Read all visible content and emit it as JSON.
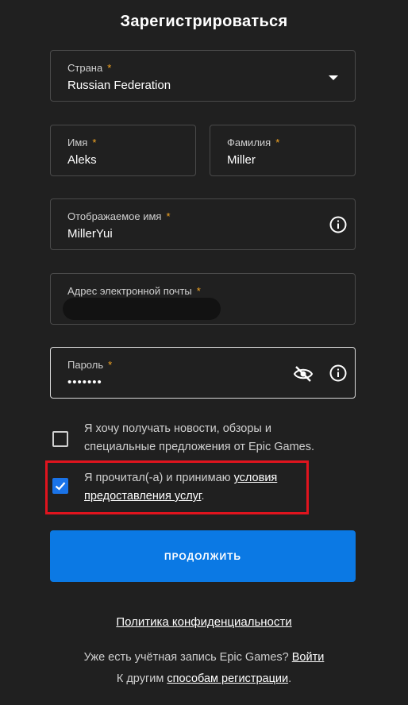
{
  "page": {
    "title": "Зарегистрироваться"
  },
  "form": {
    "country": {
      "label": "Страна",
      "required_mark": "*",
      "value": "Russian Federation"
    },
    "first_name": {
      "label": "Имя",
      "required_mark": "*",
      "value": "Aleks"
    },
    "last_name": {
      "label": "Фамилия",
      "required_mark": "*",
      "value": "Miller"
    },
    "display_name": {
      "label": "Отображаемое имя",
      "required_mark": "*",
      "value": "MillerYui"
    },
    "email": {
      "label": "Адрес электронной почты",
      "required_mark": "*",
      "value": ""
    },
    "password": {
      "label": "Пароль",
      "required_mark": "*",
      "value": "•••••••"
    }
  },
  "checkboxes": {
    "newsletter": {
      "checked": false,
      "line1": "Я хочу получать новости, обзоры и",
      "line2": "специальные предложения от Epic Games."
    },
    "terms": {
      "checked": true,
      "text_before": "Я прочитал(-а) и принимаю ",
      "link_part1": "условия",
      "link_part2": "предоставления услуг",
      "text_after": "."
    }
  },
  "buttons": {
    "continue_label": "ПРОДОЛЖИТЬ"
  },
  "links": {
    "privacy": "Политика конфиденциальности",
    "have_account_text": "Уже есть учётная запись Epic Games? ",
    "login": "Войти",
    "other_methods_text": "К другим ",
    "other_methods_link": "способам регистрации",
    "other_methods_after": "."
  },
  "colors": {
    "background": "#202020",
    "accent": "#0b79e4",
    "required": "#f5a623",
    "highlight": "#e0141e"
  },
  "icons": {
    "country_dropdown": "chevron-down-icon",
    "display_name_info": "info-icon",
    "password_visibility": "eye-off-icon",
    "password_info": "info-icon",
    "terms_check": "checkmark-icon"
  }
}
